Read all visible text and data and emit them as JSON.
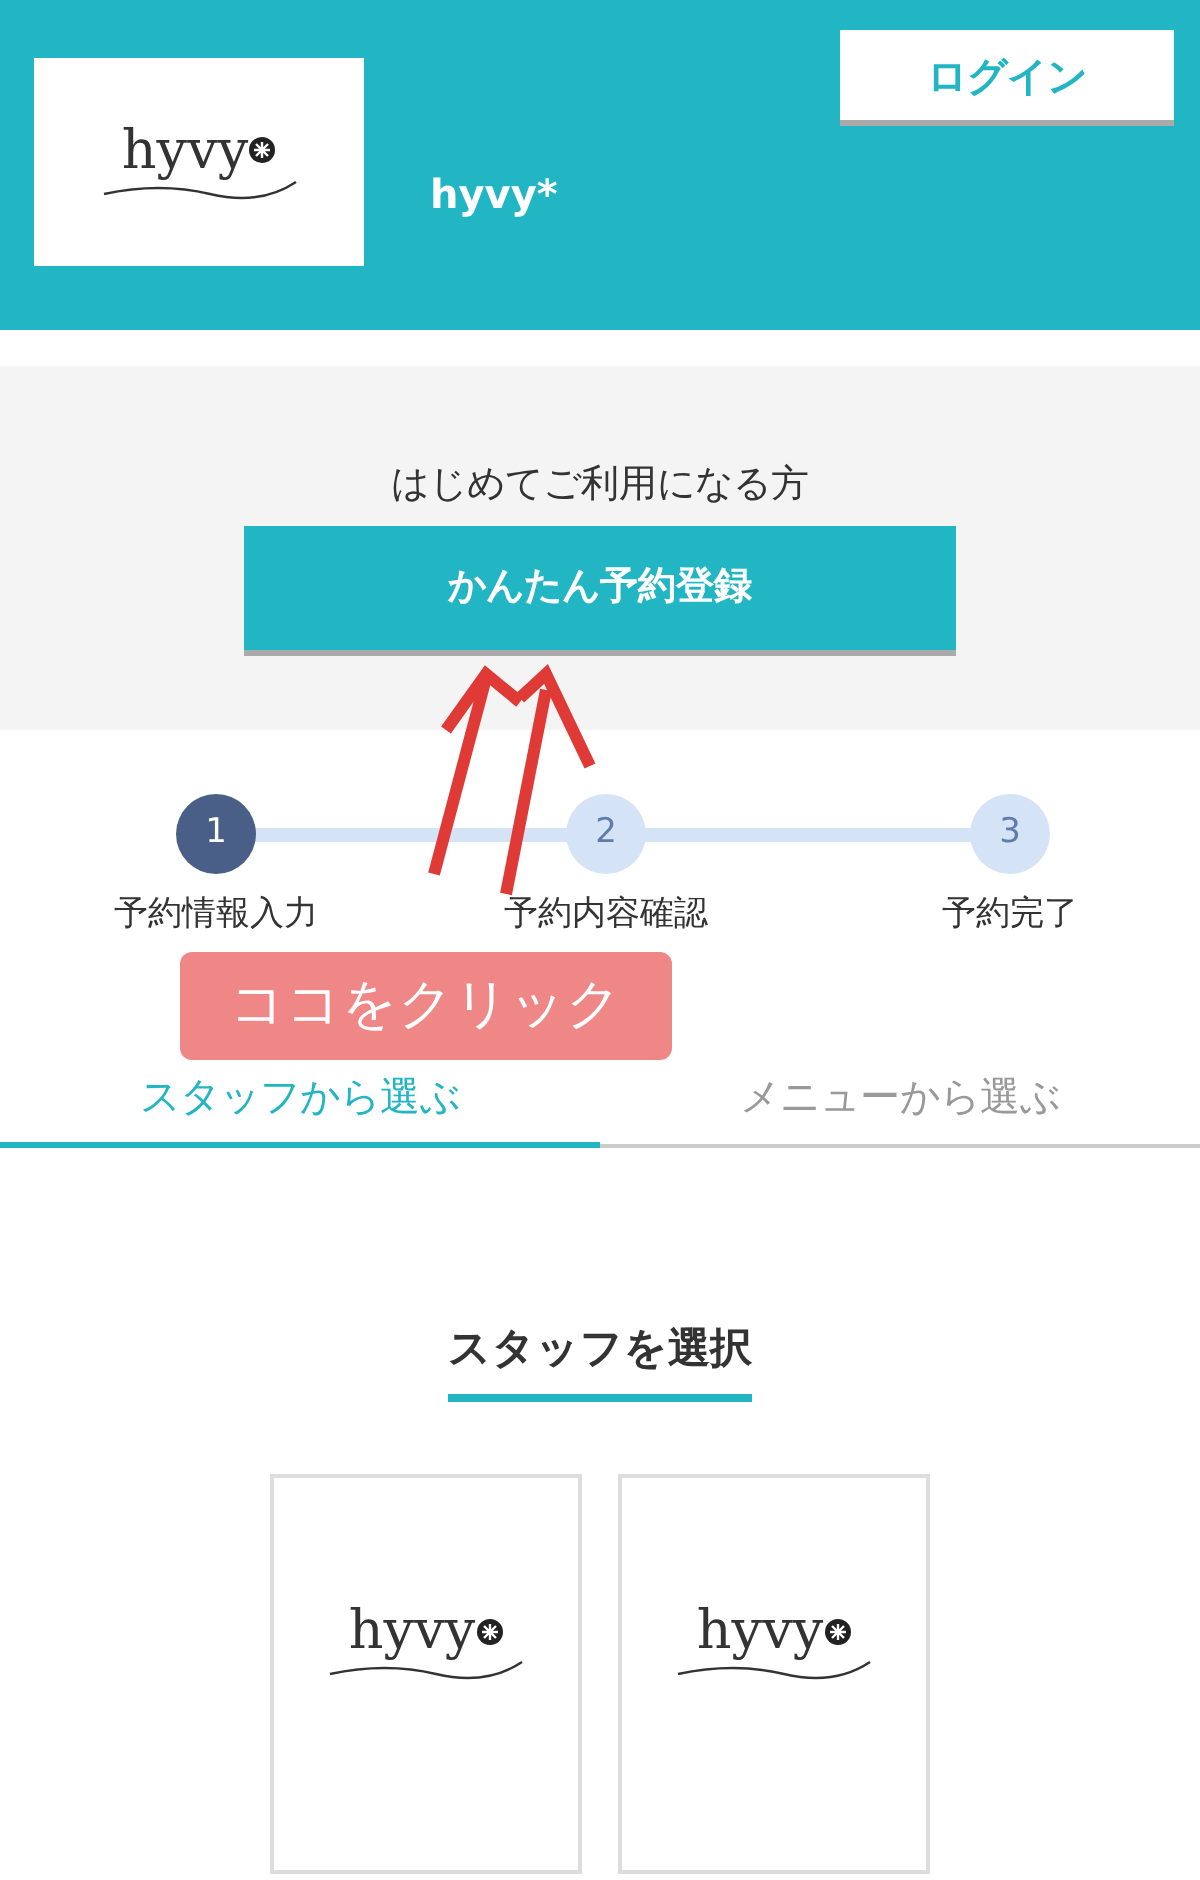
{
  "header": {
    "logo_text": "hyvy",
    "shop_name": "hyvy*",
    "login_button": "ログイン"
  },
  "first_time": {
    "text": "はじめてご利用になる方",
    "button": "かんたん予約登録"
  },
  "steps": [
    {
      "number": "1",
      "label": "予約情報入力",
      "selected": true
    },
    {
      "number": "2",
      "label": "予約内容確認",
      "selected": false
    },
    {
      "number": "3",
      "label": "予約完了",
      "selected": false
    }
  ],
  "tabs": [
    {
      "label": "スタッフから選ぶ",
      "selected": true
    },
    {
      "label": "メニューから選ぶ",
      "selected": false
    }
  ],
  "section_title": "スタッフを選択",
  "staff_cards": [
    {
      "logo_text": "hyvy"
    },
    {
      "logo_text": "hyvy"
    }
  ],
  "annotation": {
    "text": "ココをクリック"
  }
}
